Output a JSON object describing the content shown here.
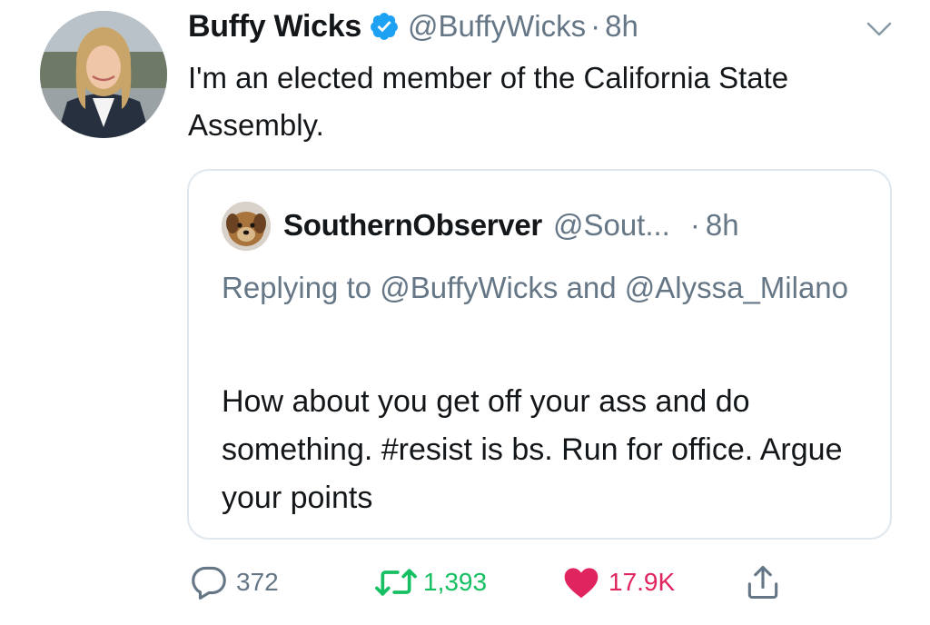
{
  "tweet": {
    "author_name": "Buffy Wicks",
    "handle": "@BuffyWicks",
    "separator": "·",
    "time": "8h",
    "text": "I'm an elected member of the California State Assembly.",
    "avatar_icon": "user-photo",
    "verified_icon": "verified-badge-icon",
    "menu_icon": "chevron-down-icon"
  },
  "quoted_tweet": {
    "author_name": "SouthernObserver",
    "handle": "@Sout...",
    "separator": "·",
    "time": "8h",
    "replying_to": "Replying to @BuffyWicks and @Alyssa_Milano",
    "text": "How about you get off your ass and do something. #resist is bs. Run for office. Argue your points",
    "avatar_icon": "dog-photo"
  },
  "actions": {
    "reply_count": "372",
    "retweet_count": "1,393",
    "like_count": "17.9K",
    "reply_icon": "reply-icon",
    "retweet_icon": "retweet-icon",
    "like_icon": "heart-icon",
    "share_icon": "share-icon"
  },
  "colors": {
    "secondary_text": "#657786",
    "retweet_green": "#17bf63",
    "like_red": "#e0245e",
    "verified_blue": "#1da1f2",
    "border": "#e1e8ed"
  }
}
